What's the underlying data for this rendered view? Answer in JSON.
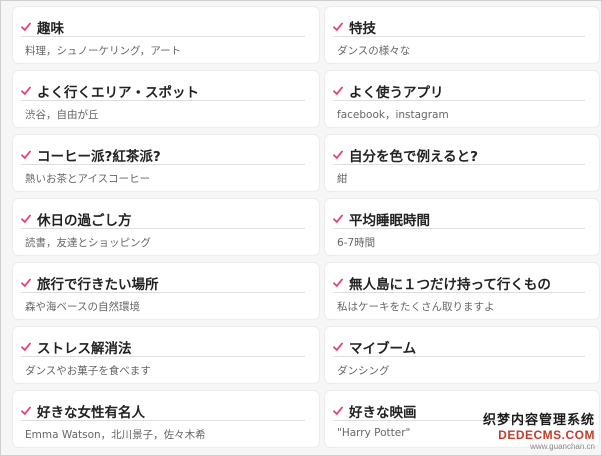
{
  "profile_items": [
    {
      "title": "趣味",
      "value": "料理，シュノーケリング，アート"
    },
    {
      "title": "特技",
      "value": "ダンスの様々な"
    },
    {
      "title": "よく行くエリア・スポット",
      "value": "渋谷，自由が丘"
    },
    {
      "title": "よく使うアプリ",
      "value": "facebook，instagram"
    },
    {
      "title": "コーヒー派?紅茶派?",
      "value": "熱いお茶とアイスコーヒー"
    },
    {
      "title": "自分を色で例えると?",
      "value": "紺"
    },
    {
      "title": "休日の過ごし方",
      "value": "読書，友達とショッピング"
    },
    {
      "title": "平均睡眠時間",
      "value": "6-7時間"
    },
    {
      "title": "旅行で行きたい場所",
      "value": "森や海ベースの自然環境"
    },
    {
      "title": "無人島に１つだけ持って行くもの",
      "value": "私はケーキをたくさん取りますよ"
    },
    {
      "title": "ストレス解消法",
      "value": "ダンスやお菓子を食べます"
    },
    {
      "title": "マイブーム",
      "value": "ダンシング"
    },
    {
      "title": "好きな女性有名人",
      "value": "Emma Watson，北川景子，佐々木希"
    },
    {
      "title": "好きな映画",
      "value": "\"Harry Potter\""
    }
  ],
  "check_icon": "check-icon",
  "accent_color": "#e0457b",
  "watermark": {
    "line1": "织梦内容管理系统",
    "line2": "DEDECMS.COM",
    "line3": "www.guanchan.cn"
  }
}
